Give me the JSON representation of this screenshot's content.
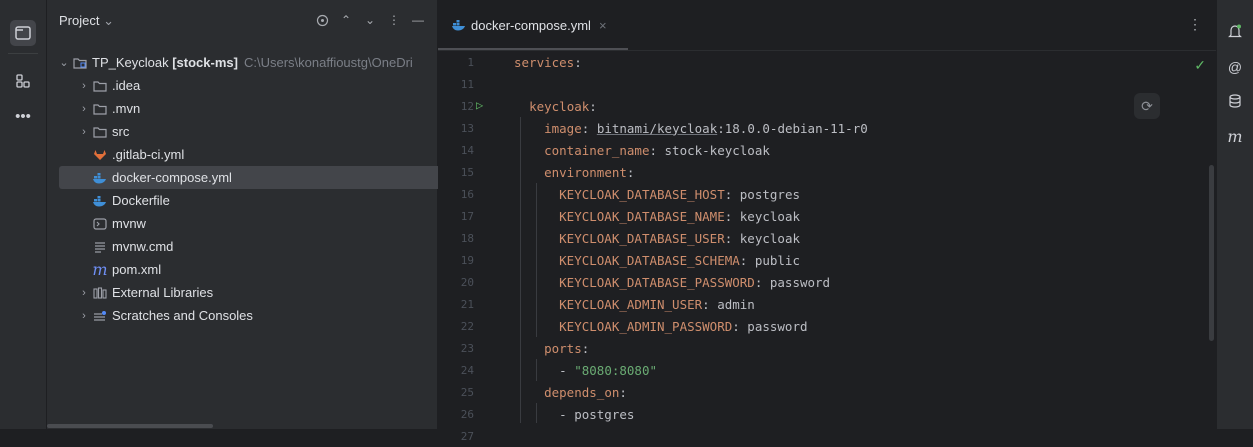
{
  "project_panel": {
    "title": "Project",
    "title_chevron": "⌄",
    "tools": [
      "crosshair-icon",
      "expand-icon",
      "collapse-icon",
      "more-icon",
      "hide-icon"
    ],
    "tree": {
      "root": {
        "name": "TP_Keycloak",
        "module": "[stock-ms]",
        "path": "C:\\Users\\konaffioustg\\OneDri"
      },
      "items": [
        {
          "label": ".idea",
          "icon": "folder-icon"
        },
        {
          "label": ".mvn",
          "icon": "folder-icon"
        },
        {
          "label": "src",
          "icon": "folder-icon"
        },
        {
          "label": ".gitlab-ci.yml",
          "icon": "gitlab-icon"
        },
        {
          "label": "docker-compose.yml",
          "icon": "docker-icon"
        },
        {
          "label": "Dockerfile",
          "icon": "docker-icon"
        },
        {
          "label": "mvnw",
          "icon": "terminal-file-icon"
        },
        {
          "label": "mvnw.cmd",
          "icon": "text-file-icon"
        },
        {
          "label": "pom.xml",
          "icon": "maven-icon"
        },
        {
          "label": "External Libraries",
          "icon": "library-icon"
        },
        {
          "label": "Scratches and Consoles",
          "icon": "scratches-icon"
        }
      ]
    }
  },
  "editor": {
    "tab": {
      "label": "docker-compose.yml",
      "close": "×"
    },
    "menu": "⋮",
    "lines": [
      {
        "n": "1",
        "tokens": [
          [
            "k",
            "services"
          ],
          [
            "p",
            ":"
          ]
        ]
      },
      {
        "n": "11",
        "tokens": []
      },
      {
        "n": "12",
        "tokens": [
          [
            "p",
            "  "
          ],
          [
            "k",
            "keycloak"
          ],
          [
            "p",
            ":"
          ]
        ]
      },
      {
        "n": "13",
        "tokens": [
          [
            "p",
            "    "
          ],
          [
            "k",
            "image"
          ],
          [
            "p",
            ": "
          ],
          [
            "u",
            "bitnami/keycloak"
          ],
          [
            "p",
            ":18.0.0-debian-11-r0"
          ]
        ]
      },
      {
        "n": "14",
        "tokens": [
          [
            "p",
            "    "
          ],
          [
            "k",
            "container_name"
          ],
          [
            "p",
            ": stock-keycloak"
          ]
        ]
      },
      {
        "n": "15",
        "tokens": [
          [
            "p",
            "    "
          ],
          [
            "k",
            "environment"
          ],
          [
            "p",
            ":"
          ]
        ]
      },
      {
        "n": "16",
        "tokens": [
          [
            "p",
            "      "
          ],
          [
            "k",
            "KEYCLOAK_DATABASE_HOST"
          ],
          [
            "p",
            ": postgres"
          ]
        ]
      },
      {
        "n": "17",
        "tokens": [
          [
            "p",
            "      "
          ],
          [
            "k",
            "KEYCLOAK_DATABASE_NAME"
          ],
          [
            "p",
            ": keycloak"
          ]
        ]
      },
      {
        "n": "18",
        "tokens": [
          [
            "p",
            "      "
          ],
          [
            "k",
            "KEYCLOAK_DATABASE_USER"
          ],
          [
            "p",
            ": keycloak"
          ]
        ]
      },
      {
        "n": "19",
        "tokens": [
          [
            "p",
            "      "
          ],
          [
            "k",
            "KEYCLOAK_DATABASE_SCHEMA"
          ],
          [
            "p",
            ": public"
          ]
        ]
      },
      {
        "n": "20",
        "tokens": [
          [
            "p",
            "      "
          ],
          [
            "k",
            "KEYCLOAK_DATABASE_PASSWORD"
          ],
          [
            "p",
            ": password"
          ]
        ]
      },
      {
        "n": "21",
        "tokens": [
          [
            "p",
            "      "
          ],
          [
            "k",
            "KEYCLOAK_ADMIN_USER"
          ],
          [
            "p",
            ": admin"
          ]
        ]
      },
      {
        "n": "22",
        "tokens": [
          [
            "p",
            "      "
          ],
          [
            "k",
            "KEYCLOAK_ADMIN_PASSWORD"
          ],
          [
            "p",
            ": password"
          ]
        ]
      },
      {
        "n": "23",
        "tokens": [
          [
            "p",
            "    "
          ],
          [
            "k",
            "ports"
          ],
          [
            "p",
            ":"
          ]
        ]
      },
      {
        "n": "24",
        "tokens": [
          [
            "p",
            "      - "
          ],
          [
            "s",
            "\"8080:8080\""
          ]
        ]
      },
      {
        "n": "25",
        "tokens": [
          [
            "p",
            "    "
          ],
          [
            "k",
            "depends_on"
          ],
          [
            "p",
            ":"
          ]
        ]
      },
      {
        "n": "26",
        "tokens": [
          [
            "p",
            "      - postgres"
          ]
        ]
      },
      {
        "n": "27",
        "tokens": []
      }
    ]
  },
  "colors": {
    "keyword": "#cf8e6d",
    "string": "#6aab73",
    "plain": "#bcbec4",
    "selected_row": "#43454a"
  }
}
